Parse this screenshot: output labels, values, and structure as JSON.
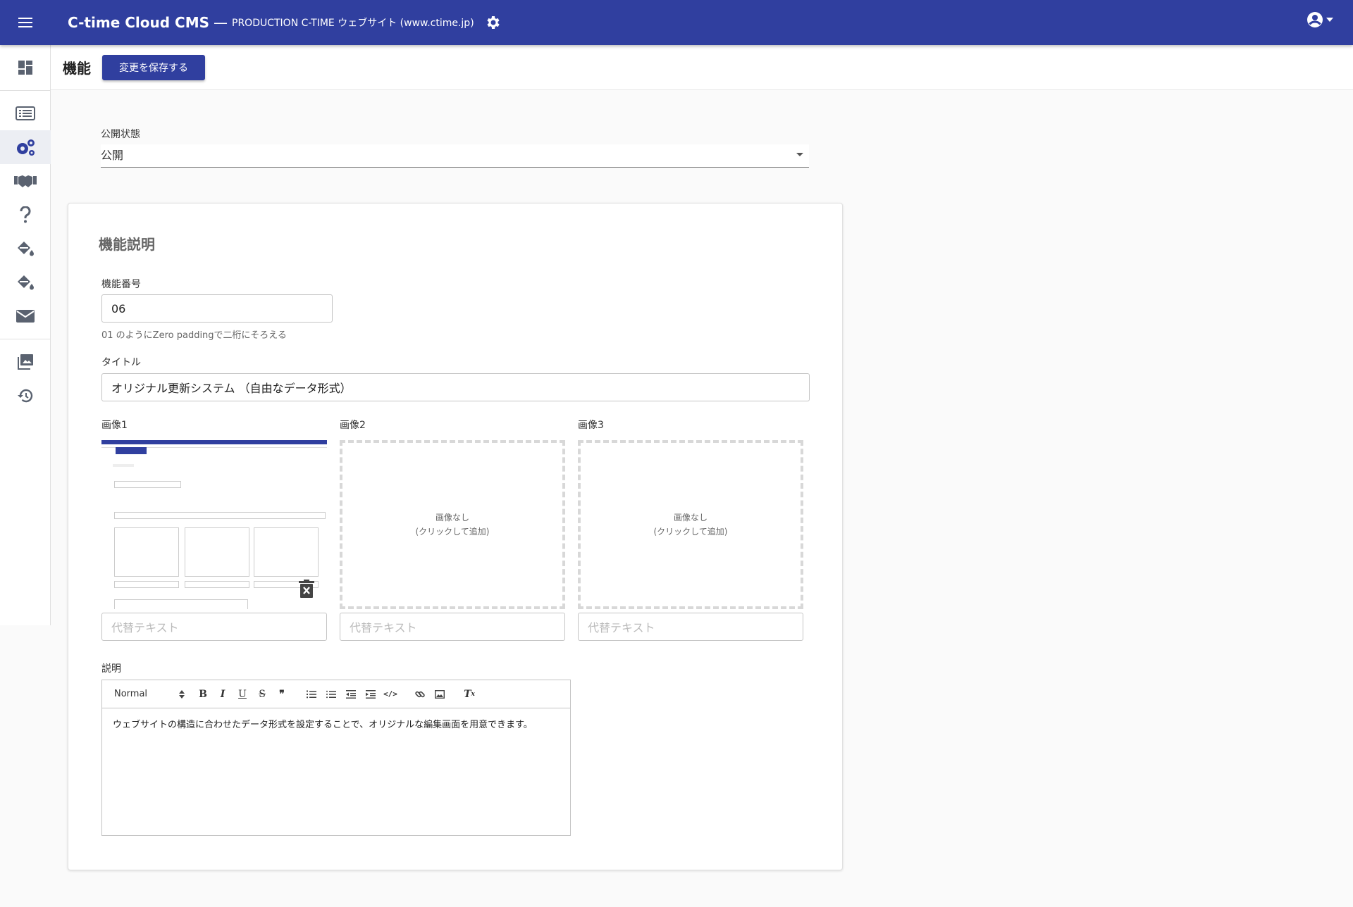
{
  "header": {
    "app_title": "C-time Cloud CMS",
    "separator": "—",
    "site_name": "PRODUCTION C-TIME ウェブサイト (www.ctime.jp)"
  },
  "page": {
    "title": "機能",
    "save_button": "変更を保存する"
  },
  "status": {
    "label": "公開状態",
    "value": "公開"
  },
  "card": {
    "title": "機能説明",
    "number_label": "機能番号",
    "number_value": "06",
    "number_hint": "01 のようにZero paddingで二桁にそろえる",
    "title_label": "タイトル",
    "title_value": "オリジナル更新システム （自由なデータ形式）",
    "images": [
      {
        "label": "画像1",
        "alt_placeholder": "代替テキスト"
      },
      {
        "label": "画像2",
        "empty_line1": "画像なし",
        "empty_line2": "(クリックして追加)",
        "alt_placeholder": "代替テキスト"
      },
      {
        "label": "画像3",
        "empty_line1": "画像なし",
        "empty_line2": "(クリックして追加)",
        "alt_placeholder": "代替テキスト"
      }
    ],
    "description_label": "説明",
    "editor": {
      "format": "Normal",
      "body": "ウェブサイトの構造に合わせたデータ形式を設定することで、オリジナルな編集画面を用意できます。"
    }
  },
  "colors": {
    "primary": "#303f9f",
    "sidebar_icon": "#5a6270",
    "sidebar_active_icon": "#303f9f"
  }
}
